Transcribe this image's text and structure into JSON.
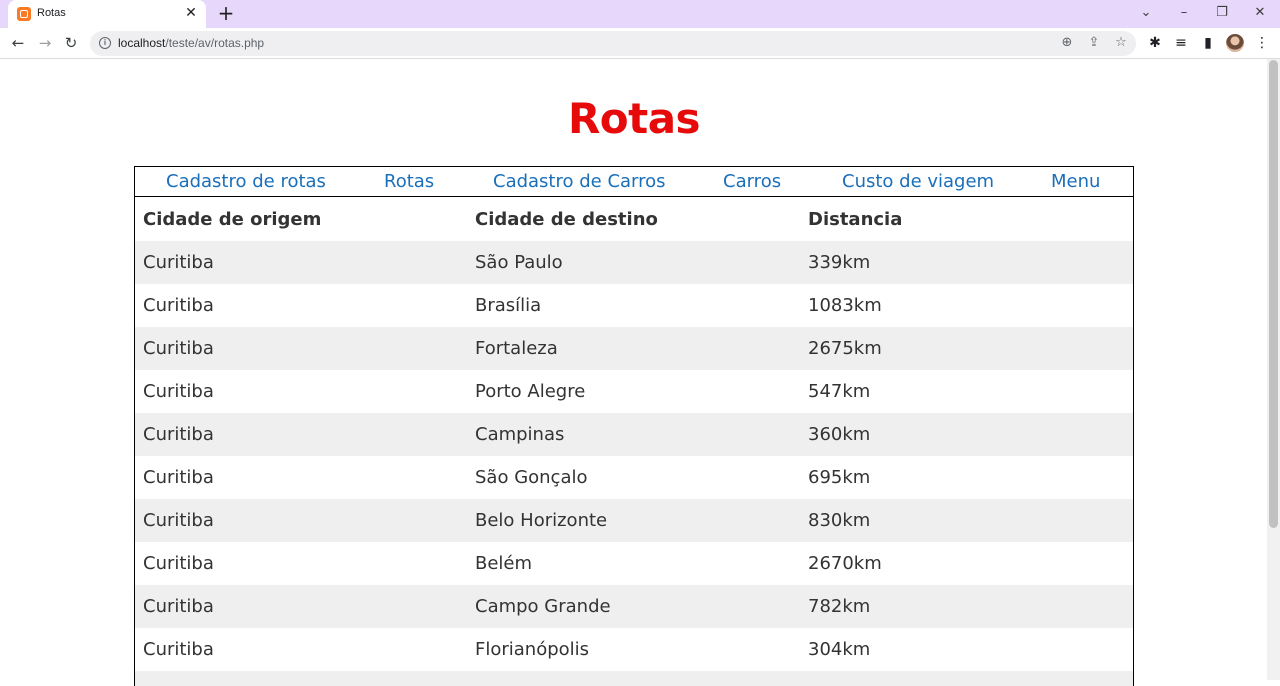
{
  "browser": {
    "tab_title": "Rotas",
    "url_host": "localhost",
    "url_path": "/teste/av/rotas.php"
  },
  "page": {
    "title": "Rotas",
    "title_color": "#e60a0a",
    "link_color": "#1a6fba"
  },
  "nav": {
    "items": [
      {
        "label": "Cadastro de rotas"
      },
      {
        "label": "Rotas"
      },
      {
        "label": "Cadastro de Carros"
      },
      {
        "label": "Carros"
      },
      {
        "label": "Custo de viagem"
      },
      {
        "label": "Menu"
      }
    ]
  },
  "table": {
    "headers": [
      "Cidade de origem",
      "Cidade de destino",
      "Distancia"
    ],
    "rows": [
      [
        "Curitiba",
        "São Paulo",
        "339km"
      ],
      [
        "Curitiba",
        "Brasília",
        "1083km"
      ],
      [
        "Curitiba",
        "Fortaleza",
        "2675km"
      ],
      [
        "Curitiba",
        "Porto Alegre",
        "547km"
      ],
      [
        "Curitiba",
        "Campinas",
        "360km"
      ],
      [
        "Curitiba",
        "São Gonçalo",
        "695km"
      ],
      [
        "Curitiba",
        "Belo Horizonte",
        "830km"
      ],
      [
        "Curitiba",
        "Belém",
        "2670km"
      ],
      [
        "Curitiba",
        "Campo Grande",
        "782km"
      ],
      [
        "Curitiba",
        "Florianópolis",
        "304km"
      ],
      [
        "",
        "",
        ""
      ]
    ]
  }
}
